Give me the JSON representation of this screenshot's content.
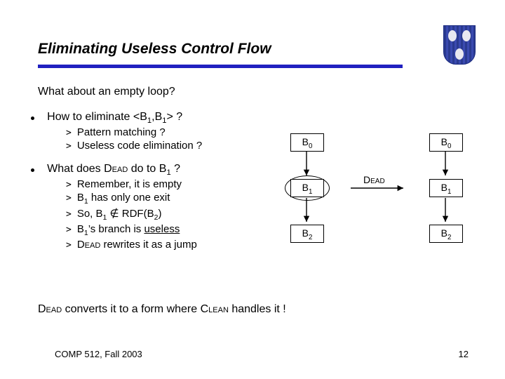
{
  "title": "Eliminating Useless Control Flow",
  "subtitle": "What about an empty loop?",
  "bullet1": {
    "lead_a": "How to eliminate <B",
    "lead_b": ",B",
    "lead_c": "> ?",
    "sub1": "Pattern matching ?",
    "sub2": "Useless code elimination ?"
  },
  "bullet2": {
    "lead_a": "What does ",
    "lead_dead": "Dead",
    "lead_b": " do to B",
    "lead_c": " ?",
    "s1": "Remember, it is empty",
    "s2_a": "B",
    "s2_b": " has only one exit",
    "s3_a": "So, B",
    "s3_b": " ∉ RDF(B",
    "s3_c": ")",
    "s4_a": "B",
    "s4_b": "’s branch is ",
    "s4_c": "useless",
    "s5_a": "Dead",
    "s5_b": " rewrites it as a jump"
  },
  "diagram": {
    "b0": "B",
    "b0s": "0",
    "b1": "B",
    "b1s": "1",
    "b2": "B",
    "b2s": "2",
    "dead": "Dead"
  },
  "bottom": {
    "a": "Dead",
    "b": " converts it to a form where ",
    "c": "Clean",
    "d": " handles it !"
  },
  "footer_left": "COMP 512, Fall 2003",
  "footer_right": "12"
}
